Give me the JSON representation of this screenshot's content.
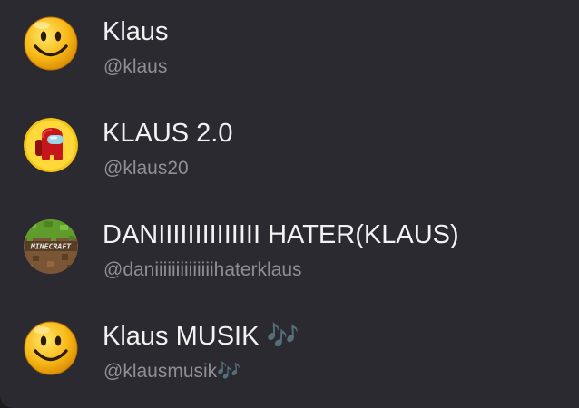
{
  "results": [
    {
      "display_name": "Klaus",
      "handle": "@klaus",
      "avatar": "smiley-face-icon"
    },
    {
      "display_name": "KLAUS 2.0",
      "handle": "@klaus20",
      "avatar": "among-us-crewmate-icon"
    },
    {
      "display_name": "DANIIIIIIIIIIIIII HATER(KLAUS)",
      "handle": "@daniiiiiiiiiiiiiihaterklaus",
      "avatar": "minecraft-grass-block-icon"
    },
    {
      "display_name": "Klaus MUSIK 🎶",
      "handle": "@klausmusik🎶",
      "avatar": "smiley-face-icon"
    }
  ],
  "colors": {
    "background": "#2b2a30",
    "name_text": "#f2f2f4",
    "handle_text": "#8f8e96"
  }
}
